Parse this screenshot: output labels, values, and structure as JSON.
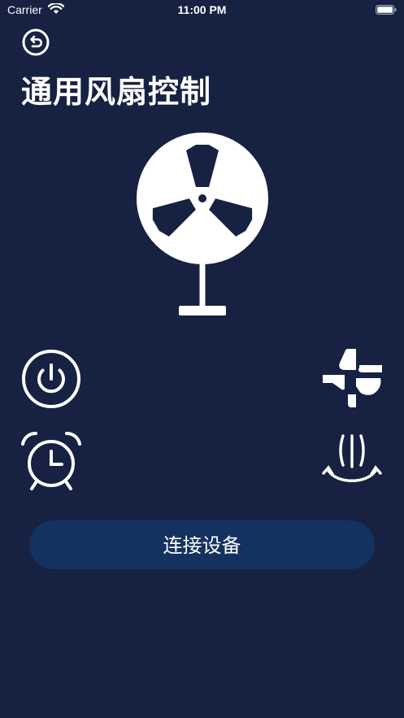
{
  "status_bar": {
    "carrier": "Carrier",
    "time": "11:00 PM"
  },
  "header": {
    "back_icon": "undo-arrow-icon",
    "title": "通用风扇控制"
  },
  "fan": {
    "icon": "standing-fan-icon"
  },
  "controls": {
    "power_icon": "power-icon",
    "timer_icon": "alarm-clock-icon",
    "mode_icon": "wind-mode-icon",
    "swing_icon": "swing-airflow-icon"
  },
  "connect": {
    "label": "连接设备"
  },
  "colors": {
    "background": "#172141",
    "button": "#14325f",
    "foreground": "#ffffff"
  }
}
